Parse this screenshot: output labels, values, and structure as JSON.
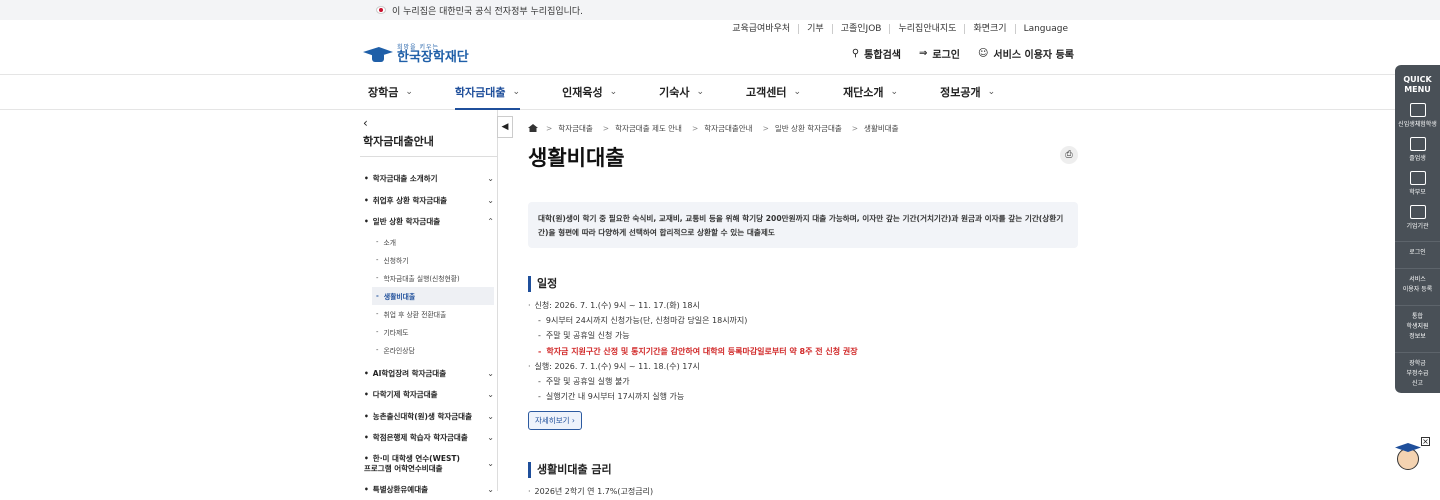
{
  "gov_banner": "이 누리집은 대한민국 공식 전자정부 누리집입니다.",
  "util_links": [
    "교육급여바우처",
    "기부",
    "고졸인JOB",
    "누리집안내지도",
    "화면크기",
    "Language"
  ],
  "logo": {
    "sub": "희망을 키우는",
    "name": "한국장학재단"
  },
  "header_actions": {
    "search": "통합검색",
    "login": "로그인",
    "register": "서비스 이용자 등록"
  },
  "gnb": [
    "장학금",
    "학자금대출",
    "인재육성",
    "기숙사",
    "고객센터",
    "재단소개",
    "정보공개"
  ],
  "lnb": {
    "title": "학자금대출안내",
    "items": [
      {
        "label": "학자금대출 소개하기"
      },
      {
        "label": "취업후 상환 학자금대출"
      },
      {
        "label": "일반 상환 학자금대출",
        "open": true,
        "children": [
          "소개",
          "신청하기",
          "학자금대출 실행(신청현황)",
          "생활비대출",
          "취업 후 상환 전환대출",
          "기타제도",
          "온라인상담"
        ]
      },
      {
        "label": "AI학업장려 학자금대출"
      },
      {
        "label": "다학기제 학자금대출"
      },
      {
        "label": "농촌출신대학(원)생 학자금대출"
      },
      {
        "label": "학점은행제 학습자 학자금대출"
      },
      {
        "label": "한·미 대학생 연수(WEST)프로그램 어학연수비대출"
      },
      {
        "label": "특별상환유예대출"
      }
    ]
  },
  "breadcrumb": [
    "학자금대출",
    "학자금대출 제도 안내",
    "학자금대출안내",
    "일반 상환 학자금대출",
    "생활비대출"
  ],
  "page_title": "생활비대출",
  "intro": "대학(원)생이 학기 중 필요한 숙식비, 교재비, 교통비 등을 위해 학기당 200만원까지 대출 가능하며, 이자만 갚는 기간(거치기간)과 원금과 이자를 갚는 기간(상환기간)을 형편에 따라 다양하게 선택하여 합리적으로 상환할 수 있는 대출제도",
  "schedule": {
    "title": "일정",
    "apply": "신청: 2026. 7. 1.(수) 9시 ~ 11. 17.(화) 18시",
    "apply_notes": [
      "9시부터 24시까지 신청가능(단, 신청마감 당일은 18시까지)",
      "주말 및 공휴일 신청 가능"
    ],
    "apply_warning": "학자금 지원구간 산정 및 통지기간을 감안하여 대학의 등록마감일로부터 약 8주 전 신청 권장",
    "exec": "실행: 2026. 7. 1.(수) 9시 ~ 11. 18.(수) 17시",
    "exec_notes": [
      "주말 및 공휴일 실행 불가",
      "실행기간 내 9시부터 17시까지 실행 가능"
    ],
    "more": "자세히보기"
  },
  "rate": {
    "title": "생활비대출 금리",
    "text": "2026년 2학기 연 1.7%(고정금리)"
  },
  "quick": {
    "head1": "QUICK",
    "head2": "MENU",
    "items": [
      "신입생체험학생",
      "졸업생",
      "학부모",
      "기업기관"
    ],
    "texts": [
      "로그인",
      "서비스",
      "이용자 등록",
      "통합",
      "학생지원",
      "정보보",
      "장학금",
      "부정수급",
      "신고"
    ]
  }
}
